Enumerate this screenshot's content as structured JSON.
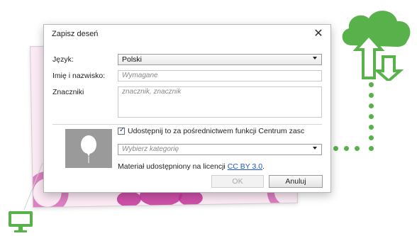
{
  "dialog": {
    "title": "Zapisz deseń",
    "close_label": "✕",
    "language": {
      "label": "Język:",
      "value": "Polski"
    },
    "name": {
      "label": "Imię i nazwisko:",
      "placeholder": "Wymagane"
    },
    "tags": {
      "label": "Znaczniki",
      "placeholder": "znacznik, znacznik"
    },
    "share": {
      "checked": true,
      "label": "Udostępnij to za pośrednictwem funkcji Centrum zasc"
    },
    "category": {
      "placeholder": "Wybierz kategorię"
    },
    "licence": {
      "text": "Materiał udostępniony na licencji",
      "link": "CC BY 3.0",
      "suffix": "."
    },
    "buttons": {
      "ok": "OK",
      "cancel": "Anuluj"
    }
  },
  "colors": {
    "accent_green": "#58b14a",
    "pattern_pink": "#c4359a",
    "link_blue": "#1a56c8"
  },
  "icons": [
    "cloud-sync-icon",
    "computer-monitor-icon",
    "close-icon",
    "dropdown-arrow-icon",
    "balloon-placeholder-icon"
  ]
}
